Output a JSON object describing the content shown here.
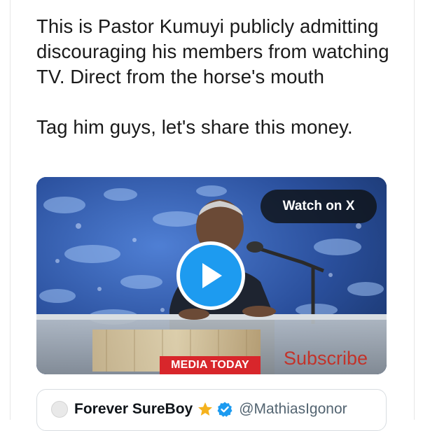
{
  "post": {
    "text_line_1": "This is Pastor Kumuyi publicly admitting discouraging his members from watching TV. Direct from the horse's mouth",
    "text_line_2": "Tag him guys, let's share this money."
  },
  "media": {
    "watch_label": "Watch on X",
    "watermark_label": "MEDIA TODAY",
    "subscribe_label": "Subscribe",
    "play_icon": "play-icon"
  },
  "quoted_post": {
    "name": "Forever SureBoy",
    "handle": "@MathiasIgonor",
    "badge_icons": [
      "star-icon",
      "verified-icon"
    ]
  },
  "colors": {
    "play_button": "#1d9bf0",
    "watermark_bg": "#d8262b",
    "subscribe_text": "#c2332a",
    "verified": "#1d9bf0",
    "star": "#f5b21d"
  }
}
